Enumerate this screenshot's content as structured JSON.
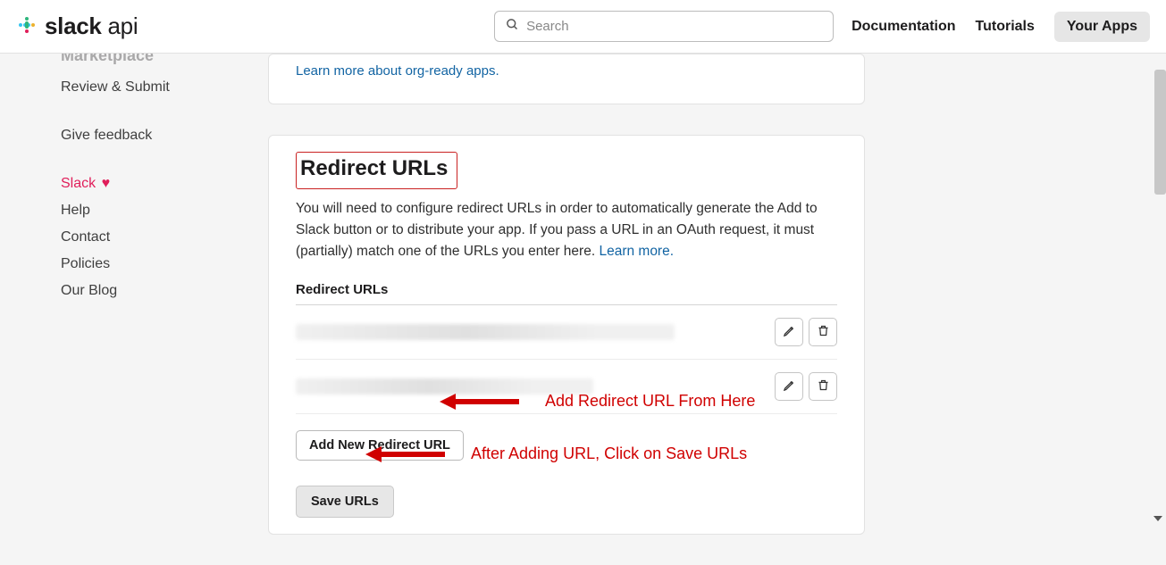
{
  "header": {
    "brand_bold": "slack",
    "brand_light": "api",
    "search_placeholder": "Search",
    "nav": {
      "documentation": "Documentation",
      "tutorials": "Tutorials",
      "your_apps": "Your Apps"
    }
  },
  "sidebar": {
    "heading_marketplace": "Marketplace",
    "review_submit": "Review & Submit",
    "give_feedback": "Give feedback",
    "slack_love": "Slack",
    "help": "Help",
    "contact": "Contact",
    "policies": "Policies",
    "blog": "Our Blog"
  },
  "card_top": {
    "learn_more": "Learn more about org-ready apps."
  },
  "redirect": {
    "title": "Redirect URLs",
    "description": "You will need to configure redirect URLs in order to automatically generate the Add to Slack button or to distribute your app. If you pass a URL in an OAuth request, it must (partially) match one of the URLs you enter here. ",
    "learn_more": "Learn more.",
    "subheading": "Redirect URLs",
    "add_new": "Add New Redirect URL",
    "save": "Save URLs"
  },
  "annotations": {
    "add": "Add Redirect URL From Here",
    "save": "After Adding URL, Click on Save URLs"
  }
}
